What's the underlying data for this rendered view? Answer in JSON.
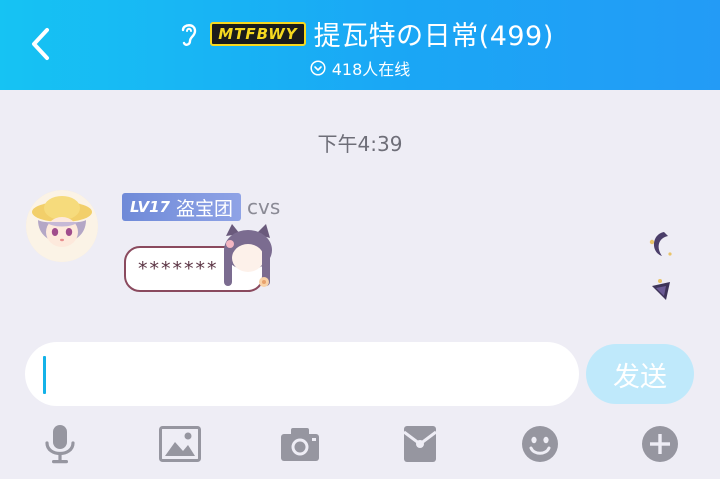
{
  "header": {
    "brand": "MTFBWY",
    "title": "提瓦特の日常(499)",
    "online": "418人在线"
  },
  "chat": {
    "timestamp": "下午4:39",
    "message": {
      "level": "LV17",
      "level_title": "盗宝团",
      "nickname": "cvs",
      "text": "*******"
    }
  },
  "input": {
    "value": "",
    "send_label": "发送"
  },
  "toolbar": {
    "items": [
      "microphone-icon",
      "image-icon",
      "camera-icon",
      "red-envelope-icon",
      "emoji-icon",
      "plus-icon"
    ]
  },
  "colors": {
    "header_start": "#16c3f3",
    "header_end": "#239bf6",
    "send_disabled": "#bfe9fb",
    "icon_gray": "#9696a0",
    "level_badge": "#7b93dd"
  }
}
